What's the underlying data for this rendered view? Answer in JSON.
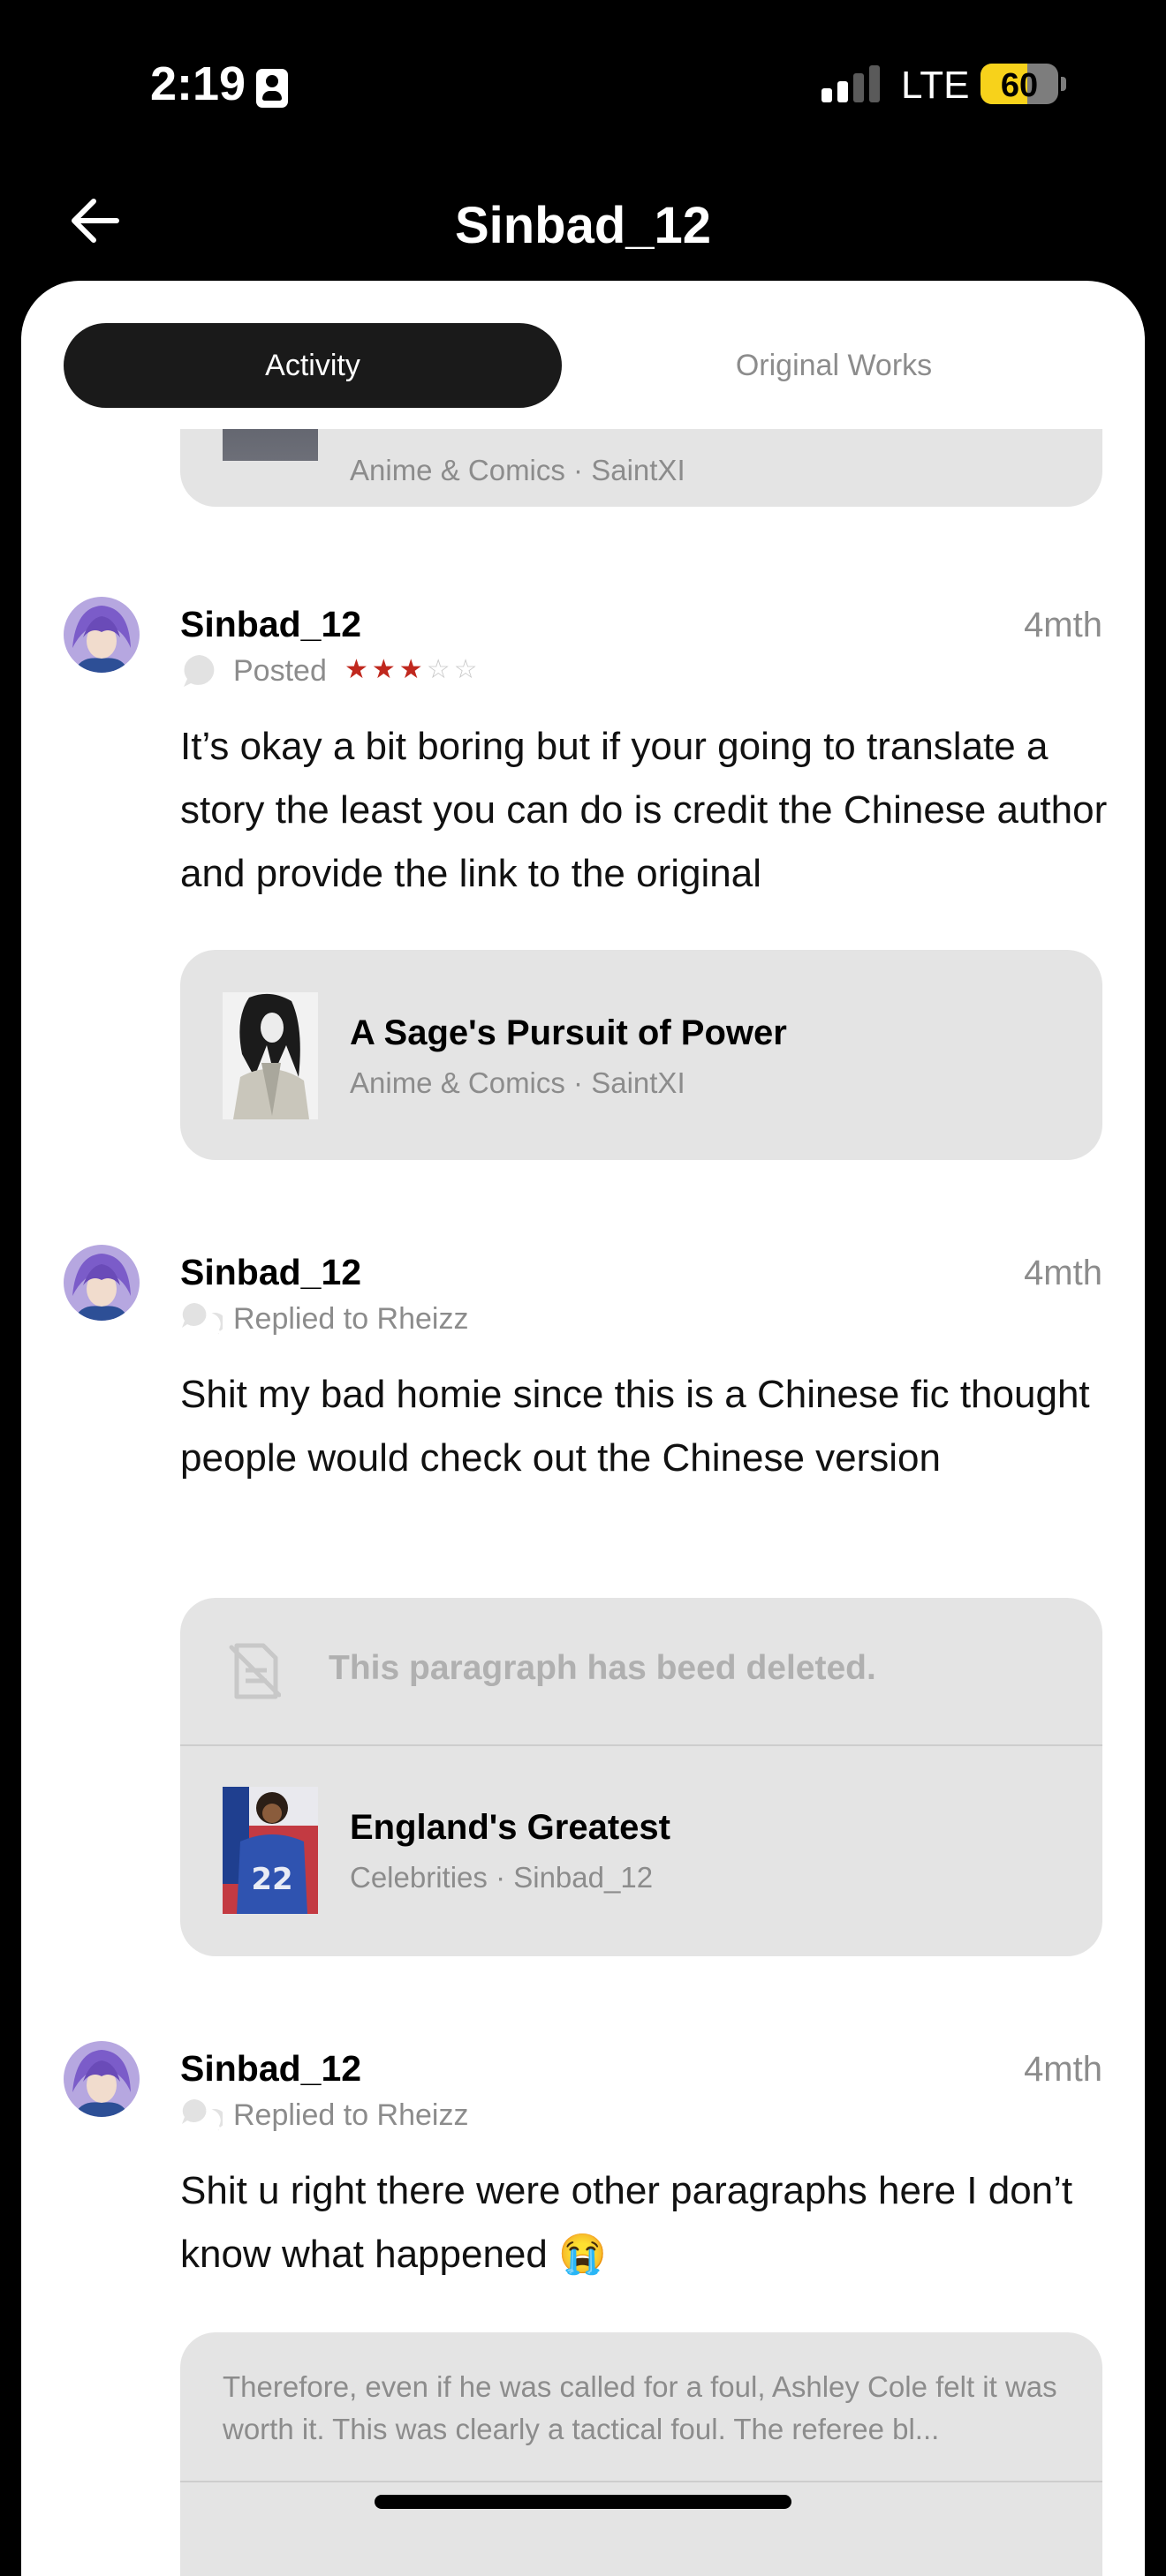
{
  "status_bar": {
    "time": "2:19",
    "network": "LTE",
    "battery": "60",
    "battery_level": 0.6,
    "signal_bars_active": 2,
    "signal_bars_total": 4
  },
  "header": {
    "title": "Sinbad_12",
    "back_icon": "arrow-left-icon"
  },
  "tabs": [
    {
      "label": "Activity",
      "active": true
    },
    {
      "label": "Original Works",
      "active": false
    }
  ],
  "feed": {
    "partial_card": {
      "meta_category": "Anime & Comics",
      "meta_author": "SaintXI"
    },
    "items": [
      {
        "username": "Sinbad_12",
        "time": "4mth",
        "action": "Posted",
        "action_icon": "speech-bubble-icon",
        "rating": 3,
        "rating_max": 5,
        "text": "It’s okay a bit boring but if your going to translate a story the least you can do is credit the Chinese author and provide the link to the original",
        "work": {
          "title": "A Sage's Pursuit of Power",
          "category": "Anime & Comics",
          "author": "SaintXI"
        }
      },
      {
        "username": "Sinbad_12",
        "time": "4mth",
        "action": "Replied to Rheizz",
        "action_icon": "reply-bubbles-icon",
        "text": "Shit my bad homie since this is a Chinese fic thought people would check out the Chinese version",
        "deleted_notice": "This paragraph has beed deleted.",
        "work": {
          "title": "England's Greatest",
          "category": "Celebrities",
          "author": "Sinbad_12"
        }
      },
      {
        "username": "Sinbad_12",
        "time": "4mth",
        "action": "Replied to Rheizz",
        "action_icon": "reply-bubbles-icon",
        "text": "Shit u right there were other paragraphs here I don’t know what happened 😭",
        "quote": "Therefore, even if he was called for a foul, Ashley Cole felt it was worth it. This was clearly a tactical foul. The referee bl..."
      }
    ]
  },
  "colors": {
    "background": "#000000",
    "sheet": "#ffffff",
    "card": "#e4e4e4",
    "tab_active": "#1a1a1a",
    "muted_text": "#8c8c8c",
    "star_filled": "#c0281e",
    "battery": "#f7d21b"
  }
}
